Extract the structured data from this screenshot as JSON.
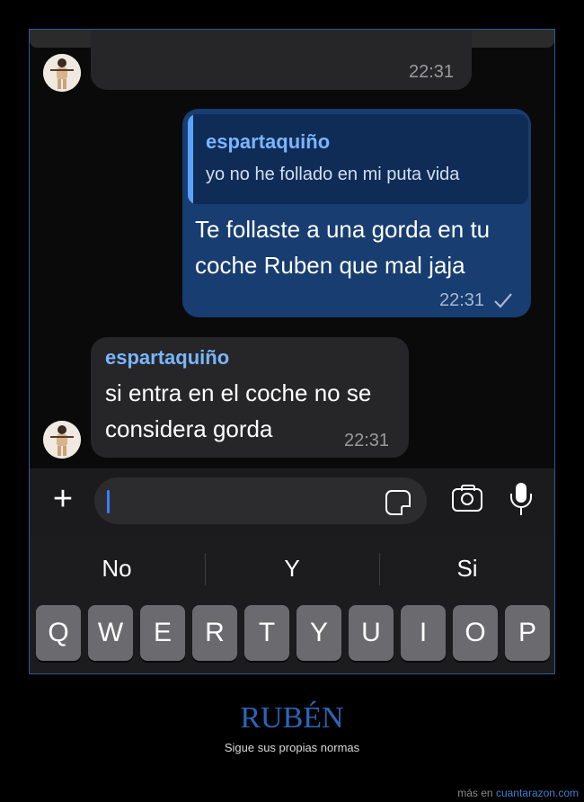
{
  "chat": {
    "prev_message_time": "22:31",
    "outgoing": {
      "quote_sender": "espartaquiño",
      "quote_text": "yo no he follado en mi puta vida",
      "text_line1": "Te follaste a una gorda en tu",
      "text_line2": "coche Ruben que mal jaja",
      "time": "22:31",
      "status_icon": "checkmark-icon"
    },
    "incoming": {
      "sender": "espartaquiño",
      "text_line1": "si entra en el coche no se",
      "text_line2": "considera gorda",
      "time": "22:31"
    }
  },
  "composer": {
    "input_value": "",
    "icons": [
      "plus-icon",
      "sticker-icon",
      "camera-icon",
      "microphone-icon"
    ]
  },
  "keyboard": {
    "suggestions": [
      "No",
      "Y",
      "Si"
    ],
    "row1": [
      "Q",
      "W",
      "E",
      "R",
      "T",
      "Y",
      "U",
      "I",
      "O",
      "P"
    ]
  },
  "caption": {
    "title": "RUBÉN",
    "subtitle": "Sigue sus propias normas"
  },
  "footer": {
    "prefix": "más en ",
    "site": "cuantarazon.com"
  },
  "colors": {
    "accent": "#79b6ff",
    "outgoing_bubble": "#173d71",
    "incoming_bubble": "#262628",
    "title": "#2a66b8"
  }
}
